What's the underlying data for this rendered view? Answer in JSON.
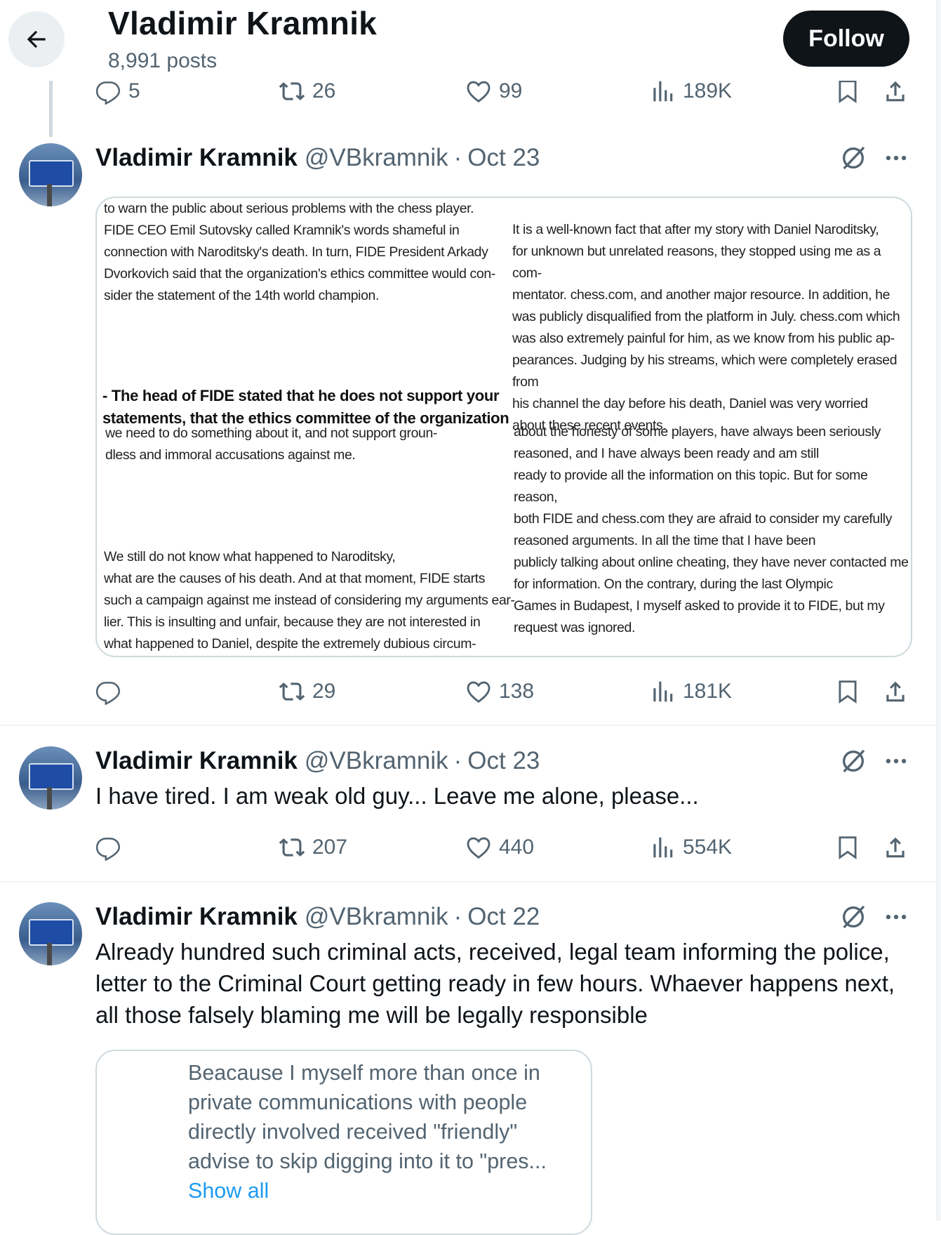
{
  "header": {
    "name": "Vladimir Kramnik",
    "posts": "8,991 posts",
    "follow_label": "Follow"
  },
  "prev_tweet_actions": {
    "replies": "5",
    "reposts": "26",
    "likes": "99",
    "views": "189K"
  },
  "tweets": [
    {
      "name": "Vladimir Kramnik",
      "handle": "@VBkramnik",
      "sep": "·",
      "date": "Oct 23",
      "image_text": {
        "left_top": [
          "to warn the public about serious problems with the chess player.",
          "FIDE CEO Emil Sutovsky called Kramnik's words shameful in",
          "connection with Naroditsky's death. In turn, FIDE President Arkady",
          "Dvorkovich said that the organization's ethics committee would con-",
          "sider the statement of the 14th world champion."
        ],
        "left_bold": [
          "- The head of FIDE stated that he does not support your",
          "statements, that the ethics committee of the organization"
        ],
        "left_mid": [
          "we need to do something about it, and not support groun-",
          "dless and immoral accusations against me."
        ],
        "left_bottom": [
          "We still do not know what happened to Naroditsky,",
          "what are the causes of his death. And at that moment, FIDE starts",
          "such a campaign against me instead of considering my arguments ear-",
          "lier. This is insulting and unfair, because they are not interested in",
          "what happened to Daniel, despite the extremely dubious circum-"
        ],
        "right_top": [
          "It is a well-known fact that after my story with Daniel Naroditsky,",
          "for unknown but unrelated reasons, they stopped using me as a com-",
          "mentator. chess.com, and another major resource. In addition, he",
          "was publicly disqualified from the platform in July. chess.com which",
          "was also extremely painful for him, as we know from his public ap-",
          "pearances. Judging by his streams, which were completely erased from",
          "his channel the day before his death, Daniel was very worried",
          "about these recent events."
        ],
        "right_bottom": [
          "about the honesty of some players, have always been seriously",
          "reasoned, and I have always been ready and am still",
          "ready to provide all the information on this topic. But for some reason,",
          "both FIDE and chess.com they are afraid to consider my carefully",
          "reasoned arguments. In all the time that I have been",
          "publicly talking about online cheating, they have never contacted me",
          "for information. On the contrary, during the last Olympic",
          "Games in Budapest, I myself asked to provide it to FIDE, but my",
          "request was ignored."
        ]
      },
      "actions": {
        "replies": "",
        "reposts": "29",
        "likes": "138",
        "views": "181K"
      }
    },
    {
      "name": "Vladimir Kramnik",
      "handle": "@VBkramnik",
      "sep": "·",
      "date": "Oct 23",
      "text": "I have tired. I am weak old guy... Leave me alone, please...",
      "actions": {
        "replies": "",
        "reposts": "207",
        "likes": "440",
        "views": "554K"
      }
    },
    {
      "name": "Vladimir Kramnik",
      "handle": "@VBkramnik",
      "sep": "·",
      "date": "Oct 22",
      "text": "Already hundred such criminal acts, received, legal team informing the police, letter to the Criminal Court getting ready in few hours. Whaever happens next, all those falsely blaming me will be legally responsible",
      "quote": {
        "text": "Beacause I myself more than once in private communications with people directly involved received \"friendly\" advise to skip digging into it to \"pres...",
        "show_all": "Show all"
      }
    }
  ],
  "icons": [
    "back-arrow-icon",
    "reply-icon",
    "repost-icon",
    "like-icon",
    "views-icon",
    "bookmark-icon",
    "share-icon",
    "grok-icon",
    "more-icon"
  ],
  "colors": {
    "text": "#0f1419",
    "muted": "#536471",
    "link": "#1d9bf0",
    "border": "#cfd9de"
  }
}
